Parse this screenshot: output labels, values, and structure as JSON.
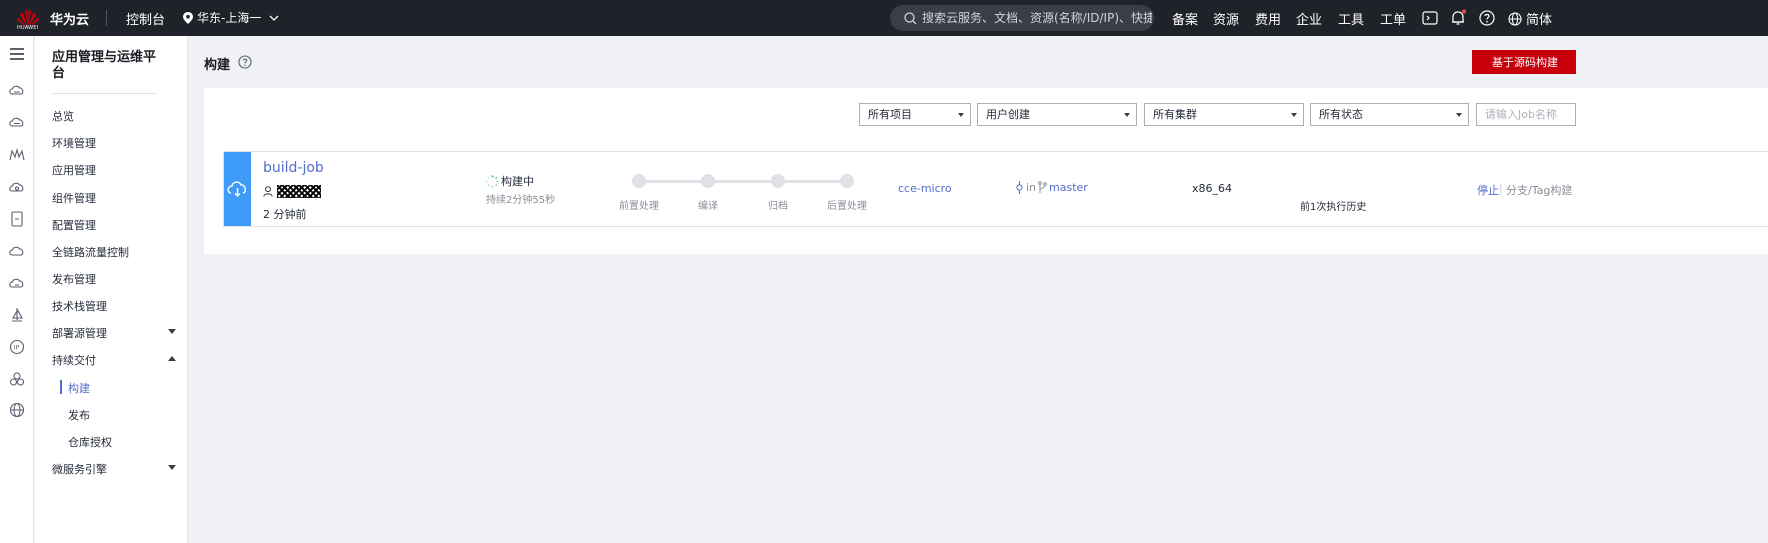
{
  "header": {
    "logo_text": "HUAWEI",
    "brand": "华为云",
    "console": "控制台",
    "region": "华东-上海一",
    "search_placeholder": "搜索云服务、文档、资源(名称/ID/IP)、快捷...",
    "nav": [
      "备案",
      "资源",
      "费用",
      "企业",
      "工具",
      "工单"
    ],
    "language": "简体",
    "brand_color": "#c7000b"
  },
  "sidebar": {
    "title": "应用管理与运维平台",
    "items": [
      {
        "label": "总览"
      },
      {
        "label": "环境管理"
      },
      {
        "label": "应用管理"
      },
      {
        "label": "组件管理"
      },
      {
        "label": "配置管理"
      },
      {
        "label": "全链路流量控制"
      },
      {
        "label": "发布管理"
      },
      {
        "label": "技术栈管理"
      },
      {
        "label": "部署源管理"
      },
      {
        "label": "持续交付"
      },
      {
        "label": "构建"
      },
      {
        "label": "发布"
      },
      {
        "label": "仓库授权"
      },
      {
        "label": "微服务引擎"
      }
    ],
    "active_item": "构建"
  },
  "page": {
    "title": "构建",
    "create_button": "基于源码构建",
    "filters": {
      "project": "所有项目",
      "creator": "用户创建",
      "cluster": "所有集群",
      "status": "所有状态",
      "job_search_placeholder": "请输入Job名称"
    },
    "job": {
      "name": "build-job",
      "time_ago": "2 分钟前",
      "status": "构建中",
      "duration": "持续2分钟55秒",
      "stages": [
        "前置处理",
        "编译",
        "归档",
        "后置处理"
      ],
      "cluster": "cce-micro",
      "branch_in": "in",
      "branch": "master",
      "arch": "x86_64",
      "history": "前1次执行历史",
      "actions": {
        "stop": "停止",
        "separator": "|",
        "branch_build": "分支/Tag构建"
      }
    }
  }
}
